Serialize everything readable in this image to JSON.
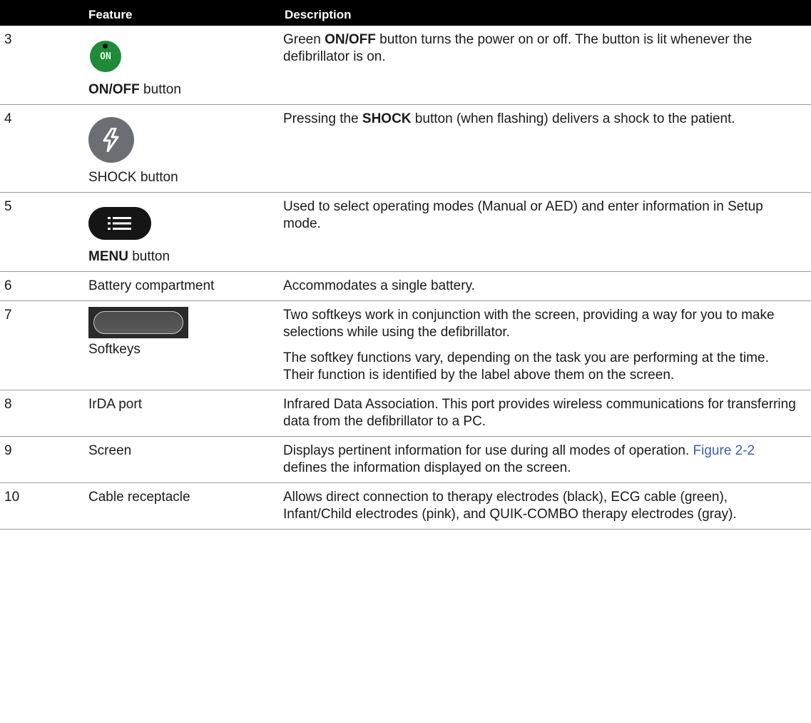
{
  "header": {
    "col_num": "",
    "col_feature": "Feature",
    "col_description": "Description"
  },
  "rows": [
    {
      "num": "3",
      "icon": "on-off-button-icon",
      "icon_text": "ON",
      "feature_bold": "ON/OFF",
      "feature_rest": " button",
      "desc_1": "Green ",
      "desc_bold": "ON/OFF",
      "desc_2": " button turns the power on or off. The button is lit whenever the defibrillator is on."
    },
    {
      "num": "4",
      "icon": "shock-button-icon",
      "feature": "SHOCK button",
      "desc_1": "Pressing the ",
      "desc_bold": "SHOCK",
      "desc_2": " button (when flashing) delivers a shock to the patient."
    },
    {
      "num": "5",
      "icon": "menu-button-icon",
      "feature_bold": "MENU",
      "feature_rest": " button",
      "desc": "Used to select operating modes (Manual or AED) and enter information in Setup mode."
    },
    {
      "num": "6",
      "feature": "Battery compartment",
      "desc": "Accommodates a single battery."
    },
    {
      "num": "7",
      "icon": "softkey-icon",
      "feature": "Softkeys",
      "desc": "Two softkeys work in conjunction with the screen, providing a way for you to make selections while using the defibrillator.",
      "desc_p2": "The softkey functions vary, depending on the task you are performing at the time. Their function is identified by the label above them on the screen."
    },
    {
      "num": "8",
      "feature": "IrDA port",
      "desc": "Infrared Data Association. This port provides wireless communications for transferring data from the defibrillator to a PC."
    },
    {
      "num": "9",
      "feature": "Screen",
      "desc_1": "Displays pertinent information for use during all modes of operation. ",
      "desc_link": "Figure 2-2",
      "desc_2": " defines the information displayed on the screen."
    },
    {
      "num": "10",
      "feature": "Cable receptacle",
      "desc": "Allows direct connection to therapy electrodes (black), ECG cable (green), Infant/Child electrodes (pink), and QUIK-COMBO therapy electrodes (gray)."
    }
  ],
  "colors": {
    "header_bg": "#000000",
    "on_button": "#1f8a3a",
    "shock_button": "#6b6e72",
    "link": "#3b5fb0"
  }
}
